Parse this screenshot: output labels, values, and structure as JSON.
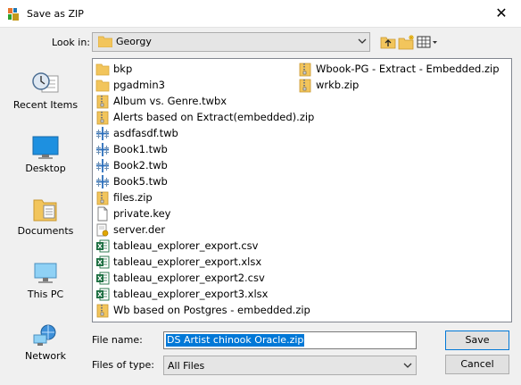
{
  "window": {
    "title": "Save as ZIP",
    "close_glyph": "✕"
  },
  "look_in": {
    "label": "Look in:",
    "value": "Georgy",
    "icon": "folder-icon"
  },
  "toolbar": [
    "up-folder-icon",
    "new-folder-icon",
    "view-menu-icon"
  ],
  "places": [
    {
      "label": "Recent Items",
      "icon": "recent-items-icon"
    },
    {
      "label": "Desktop",
      "icon": "desktop-icon"
    },
    {
      "label": "Documents",
      "icon": "documents-icon"
    },
    {
      "label": "This PC",
      "icon": "this-pc-icon"
    },
    {
      "label": "Network",
      "icon": "network-icon"
    }
  ],
  "files": [
    {
      "name": "bkp",
      "type": "folder"
    },
    {
      "name": "pgadmin3",
      "type": "folder"
    },
    {
      "name": "Album vs. Genre.twbx",
      "type": "zip"
    },
    {
      "name": "Alerts based on Extract(embedded).zip",
      "type": "zip"
    },
    {
      "name": "asdfasdf.twb",
      "type": "tableau"
    },
    {
      "name": "Book1.twb",
      "type": "tableau"
    },
    {
      "name": "Book2.twb",
      "type": "tableau"
    },
    {
      "name": "Book5.twb",
      "type": "tableau"
    },
    {
      "name": "files.zip",
      "type": "zip"
    },
    {
      "name": "private.key",
      "type": "file"
    },
    {
      "name": "server.der",
      "type": "cert"
    },
    {
      "name": "tableau_explorer_export.csv",
      "type": "excel"
    },
    {
      "name": "tableau_explorer_export.xlsx",
      "type": "excel"
    },
    {
      "name": "tableau_explorer_export2.csv",
      "type": "excel"
    },
    {
      "name": "tableau_explorer_export3.xlsx",
      "type": "excel"
    },
    {
      "name": "Wb based on Postgres - embedded.zip",
      "type": "zip"
    },
    {
      "name": "Wbook-PG - Extract - Embedded.zip",
      "type": "zip"
    },
    {
      "name": "wrkb.zip",
      "type": "zip"
    }
  ],
  "file_name": {
    "label": "File name:",
    "value": "DS Artist chinook Oracle.zip"
  },
  "file_type": {
    "label": "Files of type:",
    "value": "All Files"
  },
  "buttons": {
    "save": "Save",
    "cancel": "Cancel"
  }
}
